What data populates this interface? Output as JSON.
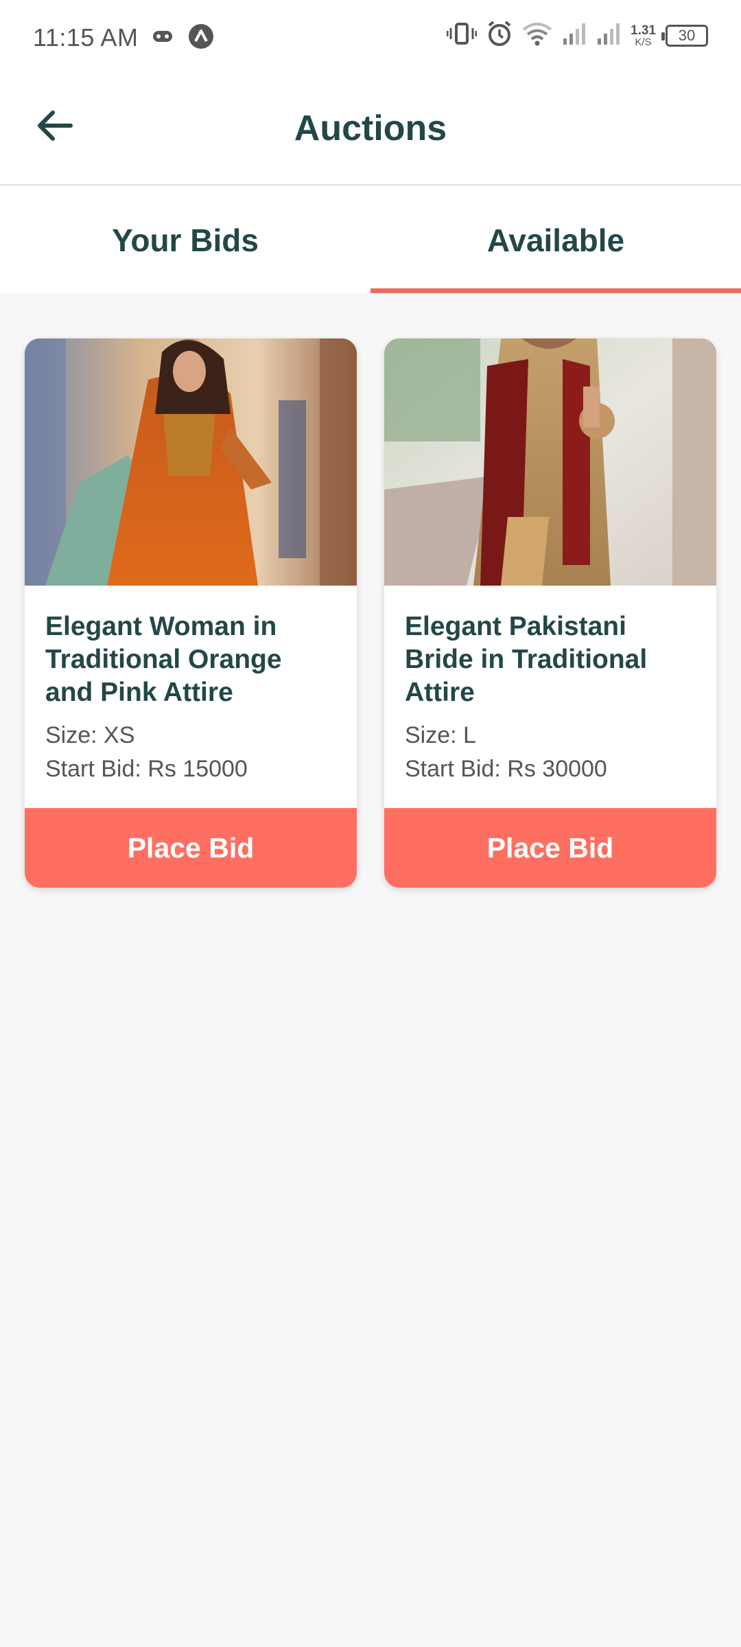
{
  "status_bar": {
    "time": "11:15 AM",
    "net_speed_value": "1.31",
    "net_speed_unit": "K/S",
    "battery_level": "30",
    "icons": [
      "game-controller-icon",
      "app-badge-icon",
      "vibrate-icon",
      "alarm-icon",
      "wifi-icon",
      "signal-icon",
      "signal-icon"
    ]
  },
  "header": {
    "title": "Auctions",
    "back_icon": "arrow-left-icon"
  },
  "tabs": [
    {
      "label": "Your Bids",
      "active": false
    },
    {
      "label": "Available",
      "active": true
    }
  ],
  "auctions": [
    {
      "title": "Elegant Woman in Traditional Orange and Pink Attire",
      "size": "Size: XS",
      "start_bid": "Start Bid: Rs 15000",
      "button_label": "Place Bid"
    },
    {
      "title": "Elegant Pakistani Bride in Traditional Attire",
      "size": "Size: L",
      "start_bid": "Start Bid: Rs 30000",
      "button_label": "Place Bid"
    }
  ],
  "colors": {
    "primary_text": "#234747",
    "accent": "#fe6f61",
    "tab_indicator": "#ef6b5e",
    "background": "#f7f7f7"
  }
}
